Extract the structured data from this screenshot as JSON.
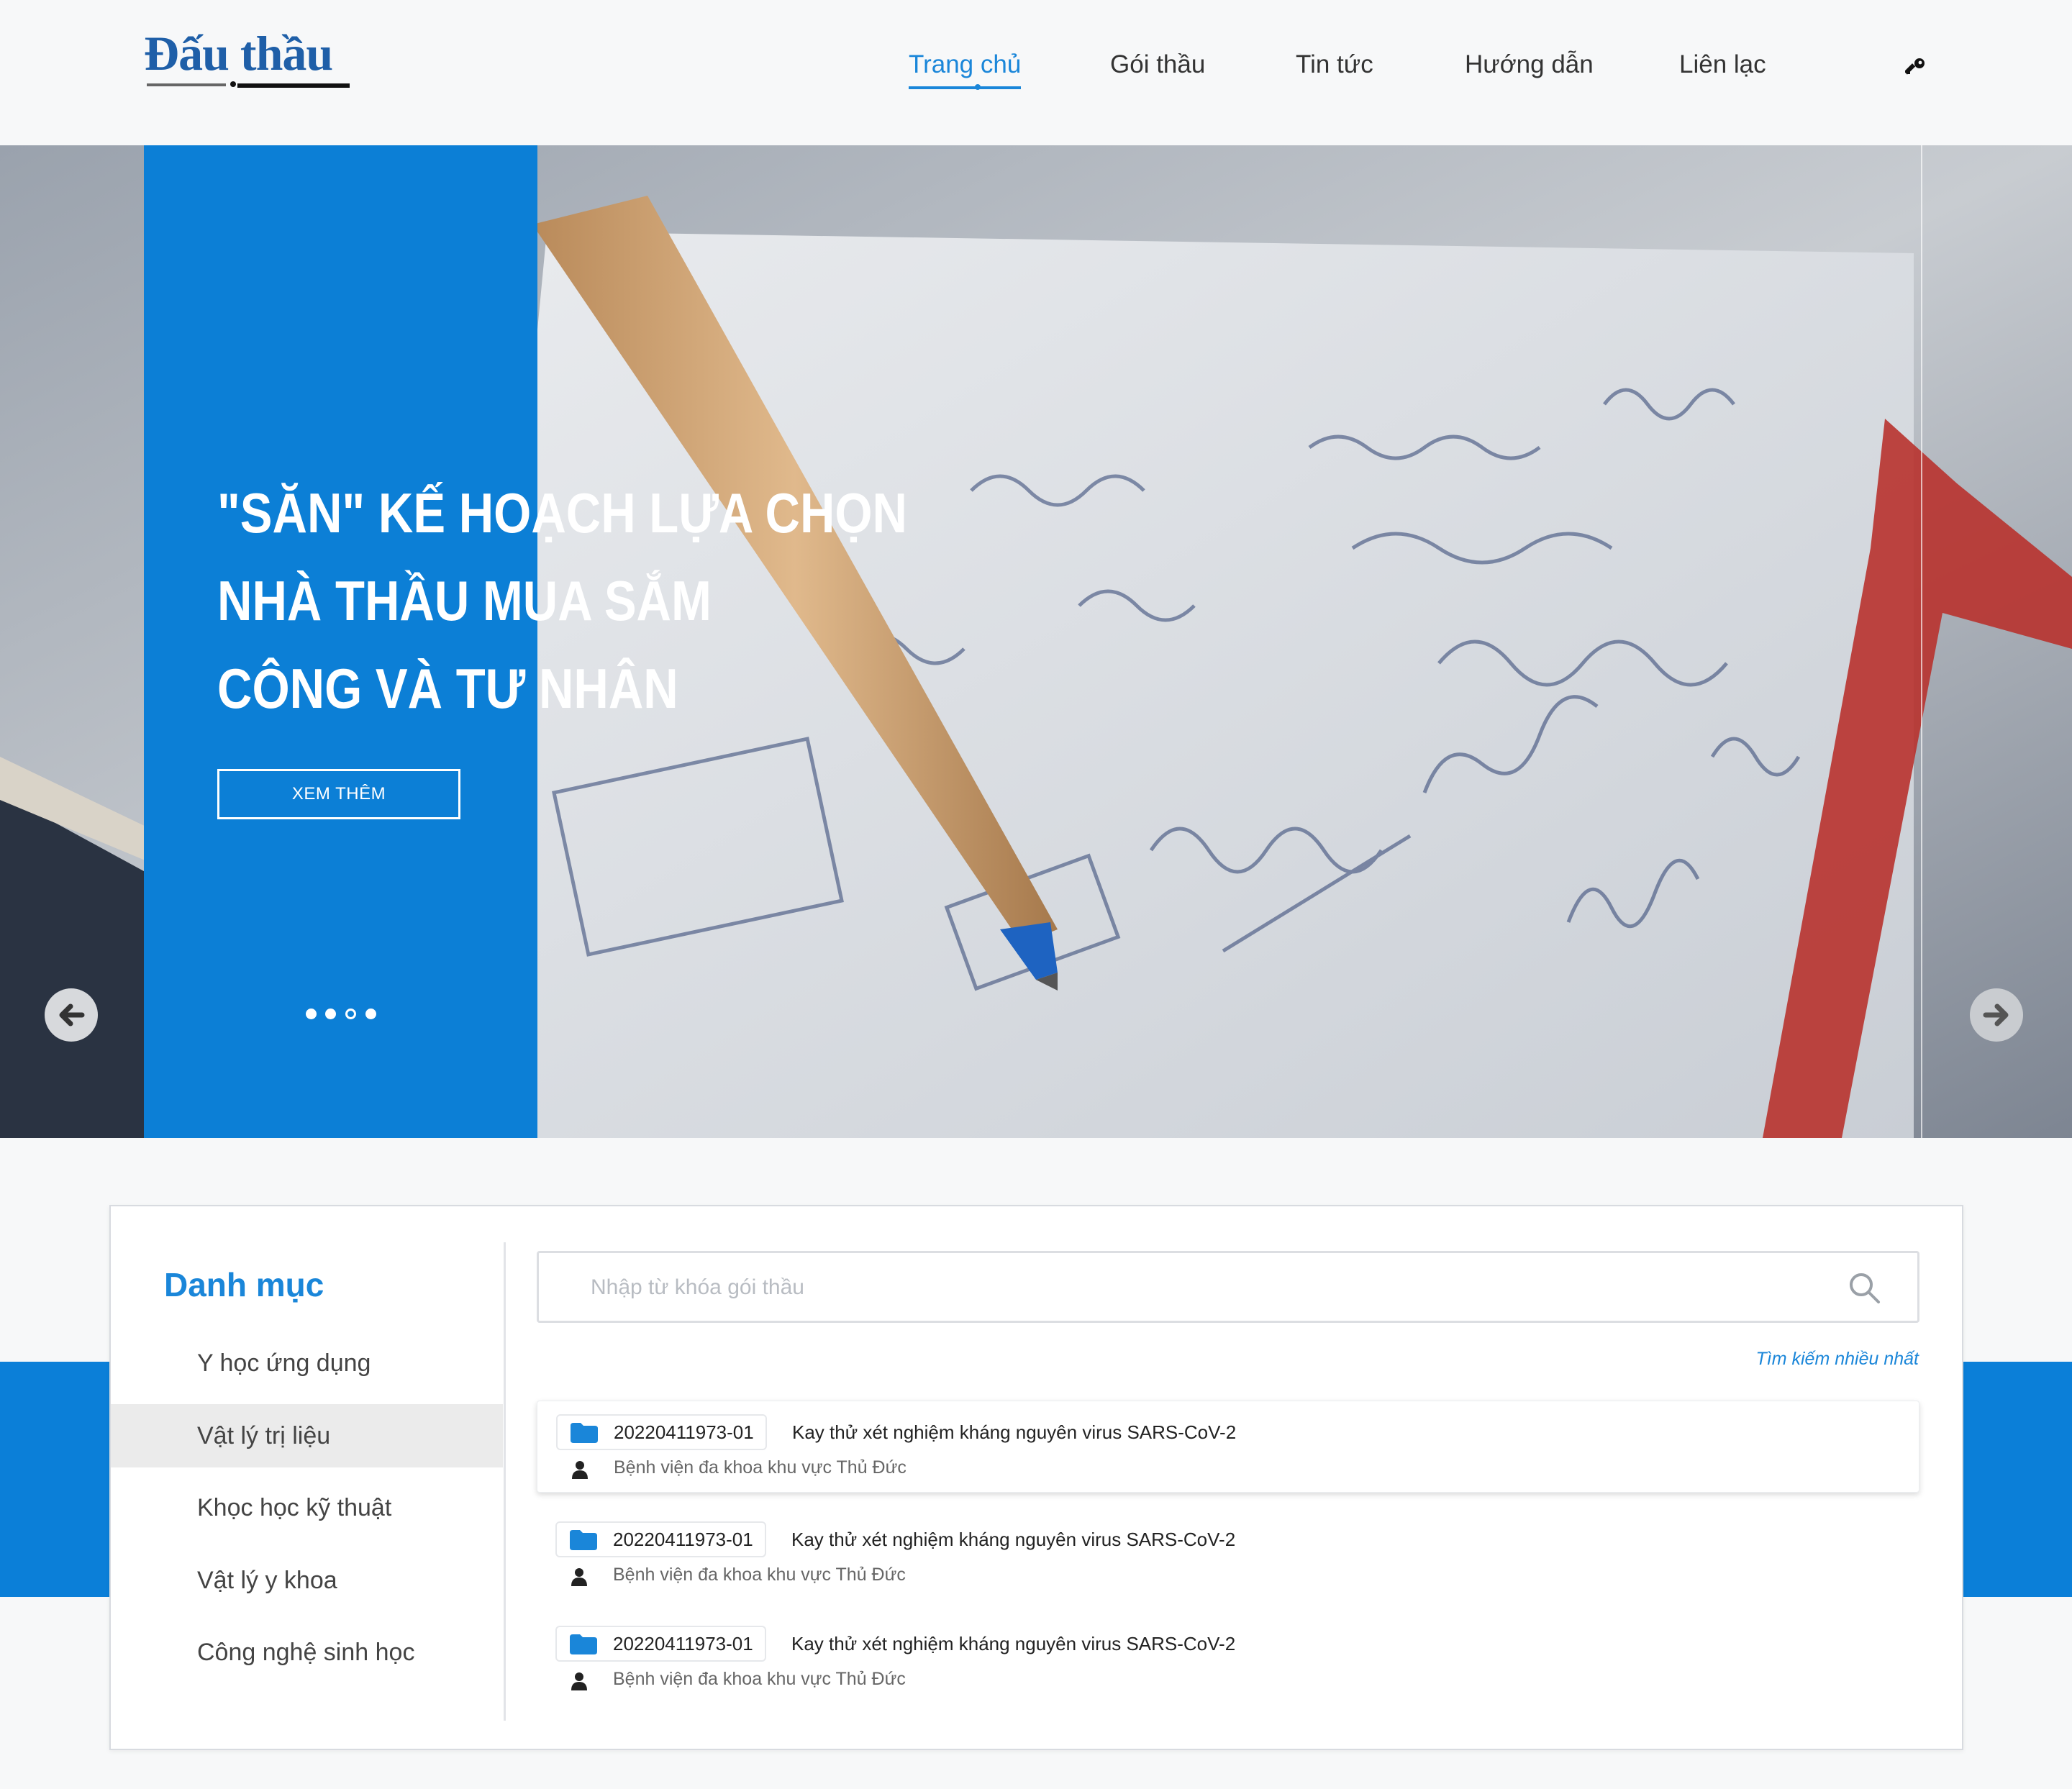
{
  "header": {
    "logo_text": "Đấu thầu",
    "nav": [
      {
        "label": "Trang chủ",
        "active": true
      },
      {
        "label": "Gói thầu",
        "active": false
      },
      {
        "label": "Tin tức",
        "active": false
      },
      {
        "label": "Hướng dẫn",
        "active": false
      },
      {
        "label": "Liên lạc",
        "active": false
      }
    ],
    "login_icon": "key-icon"
  },
  "hero": {
    "title_lines": [
      "\"SĂN\" KẾ HOẠCH LỰA CHỌN",
      "NHÀ THẦU MUA SẮM",
      "CÔNG VÀ TƯ NHÂN"
    ],
    "button_label": "XEM THÊM",
    "slide_count": 4,
    "active_slide": 3,
    "prev_icon": "arrow-left-icon",
    "next_icon": "arrow-right-icon"
  },
  "sidebar": {
    "title": "Danh mục",
    "items": [
      {
        "label": "Y học ứng dụng",
        "active": false
      },
      {
        "label": "Vật lý trị liệu",
        "active": true
      },
      {
        "label": "Khọc học kỹ thuật",
        "active": false
      },
      {
        "label": "Vật lý y khoa",
        "active": false
      },
      {
        "label": "Công nghệ sinh học",
        "active": false
      }
    ]
  },
  "search": {
    "placeholder": "Nhập từ khóa gói thầu",
    "top_search_link": "Tìm kiếm nhiều nhất"
  },
  "results": [
    {
      "code": "20220411973-01",
      "title": "Kay thử xét nghiệm kháng nguyên virus SARS-CoV-2",
      "org": "Bệnh viện đa khoa khu vực Thủ Đức",
      "highlight": true
    },
    {
      "code": "20220411973-01",
      "title": "Kay thử xét nghiệm kháng nguyên virus SARS-CoV-2",
      "org": "Bệnh viện đa khoa khu vực Thủ Đức",
      "highlight": false
    },
    {
      "code": "20220411973-01",
      "title": "Kay thử xét nghiệm kháng nguyên virus SARS-CoV-2",
      "org": "Bệnh viện đa khoa khu vực Thủ Đức",
      "highlight": false
    }
  ],
  "colors": {
    "brand_blue": "#0c7fd6",
    "link_blue": "#1a86d9",
    "logo_blue": "#1f5fa8",
    "page_bg": "#f7f8f9"
  }
}
